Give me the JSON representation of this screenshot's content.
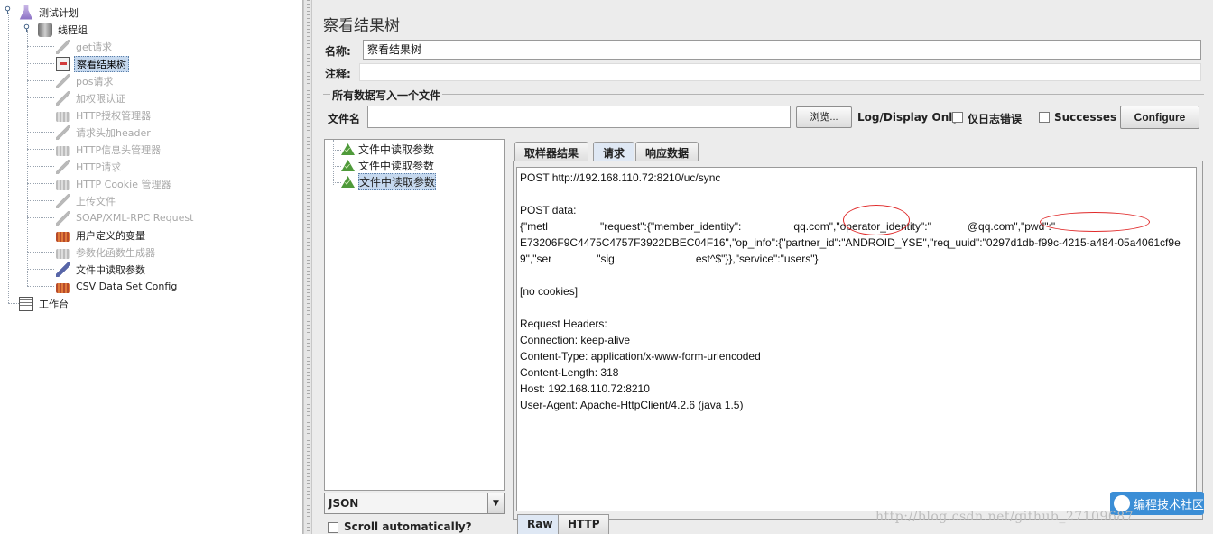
{
  "tree": {
    "root": "测试计划",
    "thread_group": "线程组",
    "items": [
      {
        "label": "get请求",
        "icon": "pipette-icon",
        "disabled": true
      },
      {
        "label": "察看结果树",
        "icon": "result-tree-icon",
        "selected": true
      },
      {
        "label": "pos请求",
        "icon": "pipette-icon",
        "disabled": true
      },
      {
        "label": "加权限认证",
        "icon": "pipette-icon",
        "disabled": true
      },
      {
        "label": "HTTP授权管理器",
        "icon": "config-gear-icon",
        "disabled": true
      },
      {
        "label": "请求头加header",
        "icon": "pipette-icon",
        "disabled": true
      },
      {
        "label": "HTTP信息头管理器",
        "icon": "config-gear-icon",
        "disabled": true
      },
      {
        "label": "HTTP请求",
        "icon": "pipette-icon",
        "disabled": true
      },
      {
        "label": "HTTP Cookie 管理器",
        "icon": "config-gear-icon",
        "disabled": true
      },
      {
        "label": "上传文件",
        "icon": "pipette-icon",
        "disabled": true
      },
      {
        "label": "SOAP/XML-RPC Request",
        "icon": "pipette-icon",
        "disabled": true
      },
      {
        "label": "用户定义的变量",
        "icon": "config-gear-icon",
        "disabled": false
      },
      {
        "label": "参数化函数生成器",
        "icon": "config-gear-icon",
        "disabled": true
      },
      {
        "label": "文件中读取参数",
        "icon": "pipette-icon",
        "disabled": false
      },
      {
        "label": "CSV Data Set Config",
        "icon": "config-gear-icon",
        "disabled": false
      }
    ],
    "workbench": "工作台"
  },
  "panel": {
    "title": "察看结果树",
    "name_label": "名称:",
    "name_value": "察看结果树",
    "comment_label": "注释:",
    "comment_value": "",
    "group_title": "所有数据写入一个文件",
    "file_label": "文件名",
    "file_value": "",
    "browse_label": "浏览...",
    "log_display_label": "Log/Display Only:",
    "errors_only_label": "仅日志错误",
    "successes_label": "Successes",
    "configure_label": "Configure"
  },
  "results": {
    "items": [
      "文件中读取参数",
      "文件中读取参数",
      "文件中读取参数"
    ],
    "selected_index": 2,
    "renderer": "JSON",
    "scroll_label": "Scroll automatically?"
  },
  "tabs": {
    "sampler_result": "取样器结果",
    "request": "请求",
    "response_data": "响应数据",
    "active": "请求"
  },
  "request_text": {
    "line1": "POST http://192.168.110.72:8210/uc/sync",
    "line3": "POST data:",
    "line4a": "{\"metl",
    "line4b": "\"request\":{\"member_identity\":",
    "line4c": "qq.com\",\"operator_identity\":\"",
    "line4d": "@qq.com\",\"pwd\":\"",
    "line5": "E73206F9C4475C4757F3922DBEC04F16\",\"op_info\":{\"partner_id\":\"ANDROID_YSE\",\"req_uuid\":\"0297d1db-f99c-4215-a484-05a4061cf9e",
    "line6a": "9\",\"ser",
    "line6b": "\"sig",
    "line6c": "est^$\"}},\"service\":\"users\"}",
    "line8": "[no cookies]",
    "line10": "Request Headers:",
    "line11": "Connection: keep-alive",
    "line12": "Content-Type: application/x-www-form-urlencoded",
    "line13": "Content-Length: 318",
    "line14": "Host: 192.168.110.72:8210",
    "line15": "User-Agent: Apache-HttpClient/4.2.6 (java 1.5)"
  },
  "bottom_tabs": {
    "raw": "Raw",
    "http": "HTTP"
  },
  "watermark": {
    "badge": "编程技术社区",
    "url": "http://blog.csdn.net/github_27109687"
  },
  "colors": {
    "selection": "#c6d9ef",
    "annotation_circle": "#e02a2a",
    "watermark_badge": "#3b8ed6"
  }
}
